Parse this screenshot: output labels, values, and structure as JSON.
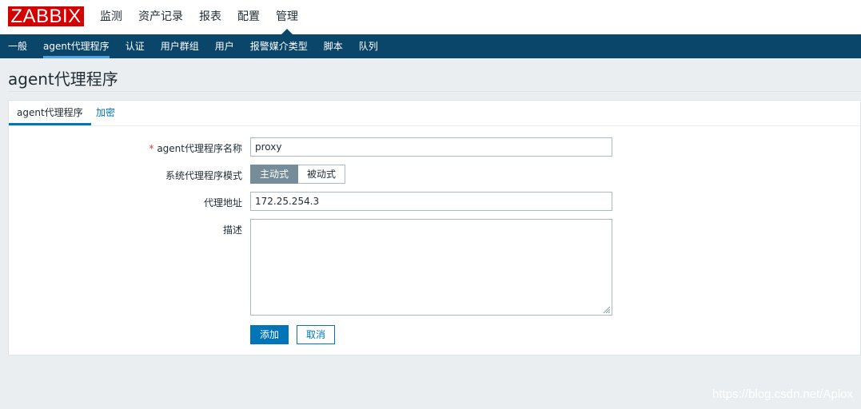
{
  "brand": {
    "logo_text": "ZABBIX",
    "color": "#d40000"
  },
  "top_nav": [
    {
      "label": "监测",
      "selected": false
    },
    {
      "label": "资产记录",
      "selected": false
    },
    {
      "label": "报表",
      "selected": false
    },
    {
      "label": "配置",
      "selected": false
    },
    {
      "label": "管理",
      "selected": true
    }
  ],
  "sub_nav": [
    {
      "label": "一般",
      "selected": false
    },
    {
      "label": "agent代理程序",
      "selected": true
    },
    {
      "label": "认证",
      "selected": false
    },
    {
      "label": "用户群组",
      "selected": false
    },
    {
      "label": "用户",
      "selected": false
    },
    {
      "label": "报警媒介类型",
      "selected": false
    },
    {
      "label": "脚本",
      "selected": false
    },
    {
      "label": "队列",
      "selected": false
    }
  ],
  "page": {
    "title": "agent代理程序"
  },
  "tabs": [
    {
      "label": "agent代理程序",
      "active": true
    },
    {
      "label": "加密",
      "active": false
    }
  ],
  "form": {
    "name": {
      "label": "agent代理程序名称",
      "required_mark": "*",
      "value": "proxy"
    },
    "mode": {
      "label": "系统代理程序模式",
      "options": [
        "主动式",
        "被动式"
      ],
      "selected": "主动式"
    },
    "address": {
      "label": "代理地址",
      "value": "172.25.254.3"
    },
    "description": {
      "label": "描述",
      "value": ""
    },
    "add_button": "添加",
    "cancel_button": "取消"
  },
  "watermark": "https://blog.csdn.net/Aplox",
  "colors": {
    "header_dark": "#0a466a",
    "accent": "#0275b8",
    "toggle_on": "#768d99"
  }
}
